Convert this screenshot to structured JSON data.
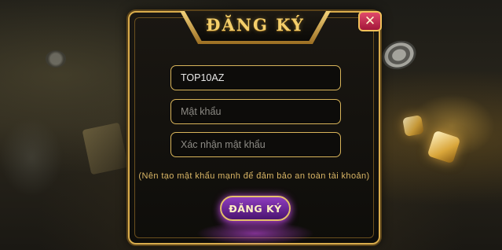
{
  "dialog": {
    "title": "ĐĂNG KÝ",
    "close_label": "✕"
  },
  "form": {
    "username": {
      "value": "TOP10AZ",
      "placeholder": ""
    },
    "password": {
      "value": "",
      "placeholder": "Mật khẩu"
    },
    "confirm_password": {
      "value": "",
      "placeholder": "Xác nhận mật khẩu"
    },
    "hint": "(Nên tạo mật khẩu mạnh để đảm bảo an toàn tài khoản)",
    "submit_label": "ĐĂNG KÝ"
  },
  "colors": {
    "accent_gold": "#d9ac4c",
    "button_purple": "#8e3dbf",
    "close_red": "#c8244a"
  }
}
